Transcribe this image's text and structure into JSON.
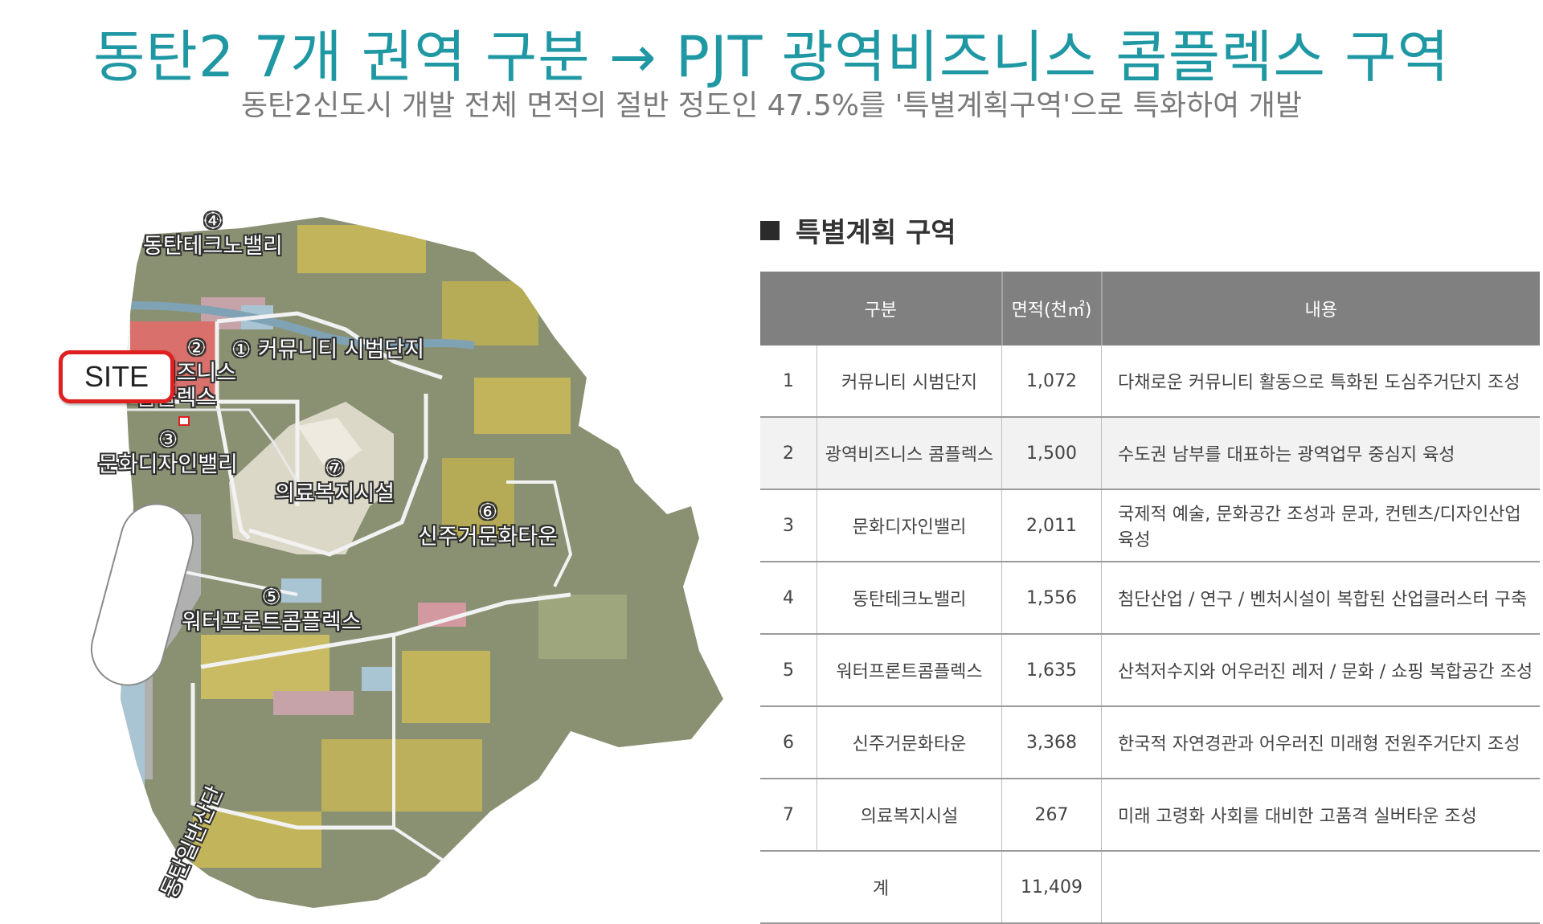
{
  "header": {
    "title": "동탄2 7개 권역 구분 → PJT 광역비즈니스 콤플렉스 구역",
    "subtitle": "동탄2신도시 개발 전체 면적의 절반 정도인 47.5%를 '특별계획구역'으로 특화하여 개발"
  },
  "map": {
    "site_label": "SITE",
    "zones": [
      {
        "num": "①",
        "name": "커뮤니티 시범단지"
      },
      {
        "num": "②",
        "name_line1": "광역비즈니스",
        "name_line2": "콤플렉스"
      },
      {
        "num": "③",
        "name": "문화디자인밸리"
      },
      {
        "num": "④",
        "name": "동탄테크노밸리"
      },
      {
        "num": "⑤",
        "name": "워터프론트콤플렉스"
      },
      {
        "num": "⑥",
        "name": "신주거문화타운"
      },
      {
        "num": "⑦",
        "name": "의료복지시설"
      }
    ],
    "industrial_label": "동탄일반산단",
    "colors": {
      "highlight": "#d9706b",
      "site_red": "#e02020",
      "base_green": "#8a9173",
      "road": "#e8e8e8",
      "water": "#a9c5d4",
      "yellow": "#c2b45a"
    }
  },
  "section": {
    "title": "특별계획 구역"
  },
  "table": {
    "headers": [
      "구분",
      "면적(천㎡)",
      "내용"
    ],
    "rows": [
      {
        "no": "1",
        "name": "커뮤니티 시범단지",
        "area": "1,072",
        "content": "다채로운 커뮤니티 활동으로 특화된 도심주거단지 조성"
      },
      {
        "no": "2",
        "name": "광역비즈니스 콤플렉스",
        "area": "1,500",
        "content": "수도권 남부를 대표하는 광역업무 중심지 육성"
      },
      {
        "no": "3",
        "name": "문화디자인밸리",
        "area": "2,011",
        "content": "국제적 예술, 문화공간 조성과 문과, 컨텐츠/디자인산업 육성"
      },
      {
        "no": "4",
        "name": "동탄테크노밸리",
        "area": "1,556",
        "content": "첨단산업 / 연구 / 벤처시설이 복합된 산업클러스터 구축"
      },
      {
        "no": "5",
        "name": "워터프론트콤플렉스",
        "area": "1,635",
        "content": "산척저수지와 어우러진 레저 / 문화 / 쇼핑 복합공간 조성"
      },
      {
        "no": "6",
        "name": "신주거문화타운",
        "area": "3,368",
        "content": "한국적 자연경관과 어우러진 미래형 전원주거단지 조성"
      },
      {
        "no": "7",
        "name": "의료복지시설",
        "area": "267",
        "content": "미래 고령화 사회를 대비한 고품격 실버타운 조성"
      }
    ],
    "total": {
      "label": "계",
      "area": "11,409"
    }
  }
}
